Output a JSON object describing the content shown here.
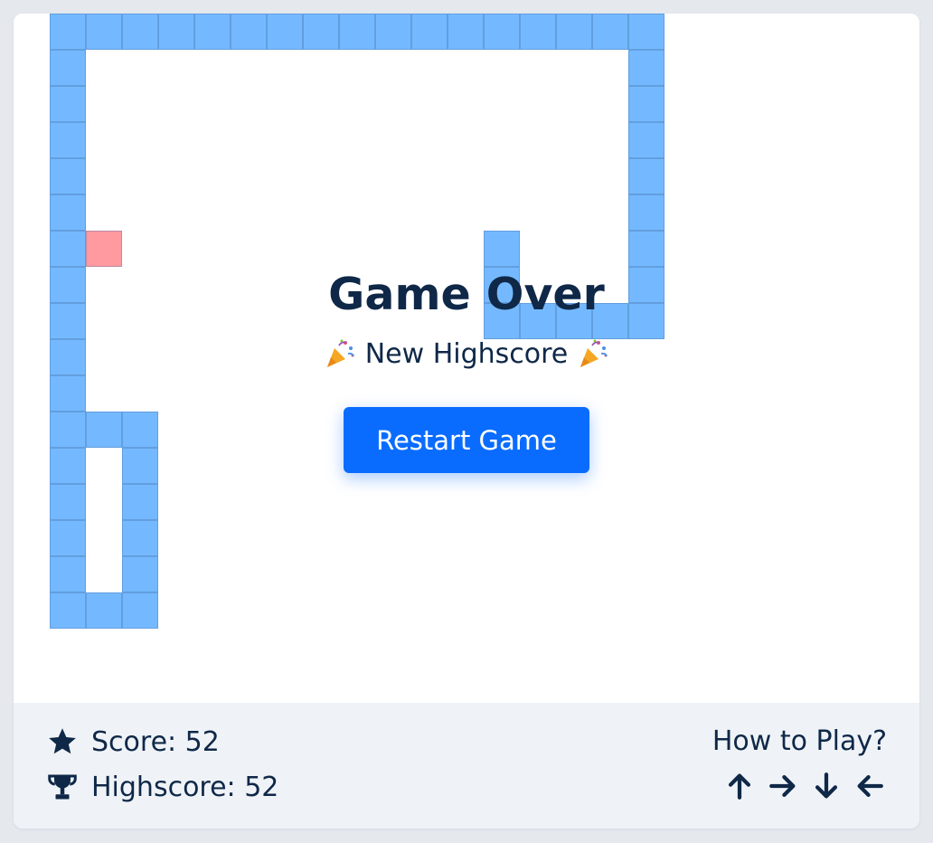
{
  "overlay": {
    "title": "Game Over",
    "subtitle": "New Highscore",
    "restart_label": "Restart Game"
  },
  "stats": {
    "score_label": "Score: 52",
    "highscore_label": "Highscore: 52"
  },
  "help": {
    "how_label": "How to Play?",
    "keys": [
      "arrow-up-icon",
      "arrow-right-icon",
      "arrow-down-icon",
      "arrow-left-icon"
    ]
  },
  "colors": {
    "snake": "#74b9ff",
    "food": "#ff9aa0",
    "accent": "#0a6cff",
    "text": "#0f2848"
  },
  "grid": {
    "cols": 25,
    "rows": 19,
    "snake": [
      [
        1,
        0
      ],
      [
        2,
        0
      ],
      [
        3,
        0
      ],
      [
        4,
        0
      ],
      [
        5,
        0
      ],
      [
        6,
        0
      ],
      [
        7,
        0
      ],
      [
        8,
        0
      ],
      [
        9,
        0
      ],
      [
        10,
        0
      ],
      [
        11,
        0
      ],
      [
        12,
        0
      ],
      [
        13,
        0
      ],
      [
        14,
        0
      ],
      [
        15,
        0
      ],
      [
        16,
        0
      ],
      [
        17,
        0
      ],
      [
        1,
        1
      ],
      [
        1,
        2
      ],
      [
        1,
        3
      ],
      [
        1,
        4
      ],
      [
        1,
        5
      ],
      [
        1,
        6
      ],
      [
        1,
        7
      ],
      [
        1,
        8
      ],
      [
        1,
        9
      ],
      [
        1,
        10
      ],
      [
        1,
        11
      ],
      [
        1,
        12
      ],
      [
        1,
        13
      ],
      [
        1,
        14
      ],
      [
        1,
        15
      ],
      [
        1,
        16
      ],
      [
        2,
        11
      ],
      [
        3,
        11
      ],
      [
        3,
        12
      ],
      [
        3,
        13
      ],
      [
        3,
        14
      ],
      [
        3,
        15
      ],
      [
        3,
        16
      ],
      [
        2,
        16
      ],
      [
        17,
        1
      ],
      [
        17,
        2
      ],
      [
        17,
        3
      ],
      [
        17,
        4
      ],
      [
        17,
        5
      ],
      [
        17,
        6
      ],
      [
        17,
        7
      ],
      [
        17,
        8
      ],
      [
        16,
        8
      ],
      [
        15,
        8
      ],
      [
        14,
        8
      ],
      [
        13,
        8
      ],
      [
        13,
        7
      ],
      [
        13,
        6
      ]
    ],
    "food": [
      2,
      6
    ]
  }
}
